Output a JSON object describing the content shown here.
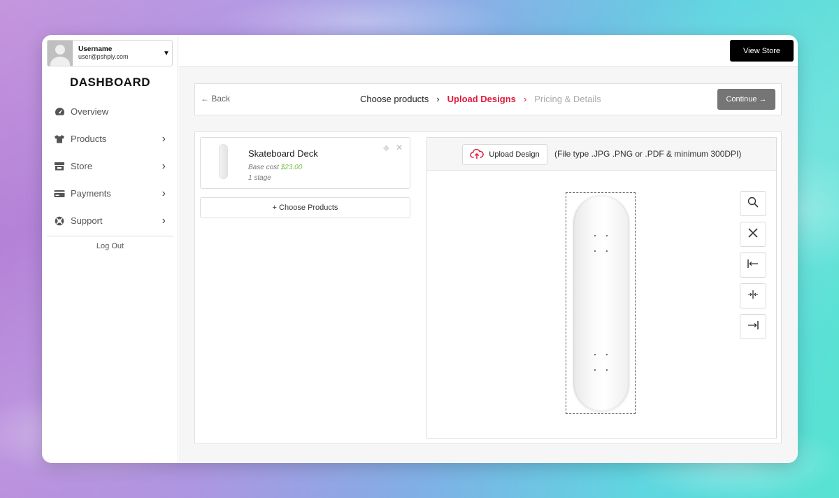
{
  "user": {
    "name": "Username",
    "email": "user@pshply.com"
  },
  "sidebar": {
    "title": "DASHBOARD",
    "items": [
      {
        "label": "Overview",
        "icon": "gauge-icon",
        "has_chevron": false
      },
      {
        "label": "Products",
        "icon": "tshirt-icon",
        "has_chevron": true
      },
      {
        "label": "Store",
        "icon": "store-icon",
        "has_chevron": true
      },
      {
        "label": "Payments",
        "icon": "credit-card-icon",
        "has_chevron": true
      },
      {
        "label": "Support",
        "icon": "lifebuoy-icon",
        "has_chevron": true
      }
    ],
    "logout": "Log Out"
  },
  "topbar": {
    "view_store": "View Store"
  },
  "steps": {
    "back": "Back",
    "items": [
      {
        "label": "Choose products",
        "state": "done"
      },
      {
        "label": "Upload Designs",
        "state": "active"
      },
      {
        "label": "Pricing & Details",
        "state": "upcoming"
      }
    ],
    "continue": "Continue"
  },
  "product": {
    "name": "Skateboard Deck",
    "base_cost_label": "Base cost",
    "price": "$23.00",
    "stage": "1 stage"
  },
  "choose_products": "Choose Products",
  "designer": {
    "upload_label": "Upload Design",
    "file_hint": "(File type .JPG .PNG or .PDF & minimum 300DPI)",
    "tools": [
      "zoom-icon",
      "close-icon",
      "align-left-icon",
      "align-center-icon",
      "align-right-icon"
    ]
  },
  "colors": {
    "accent": "#e0193b",
    "price": "#7cc04b",
    "continue": "#757575"
  }
}
